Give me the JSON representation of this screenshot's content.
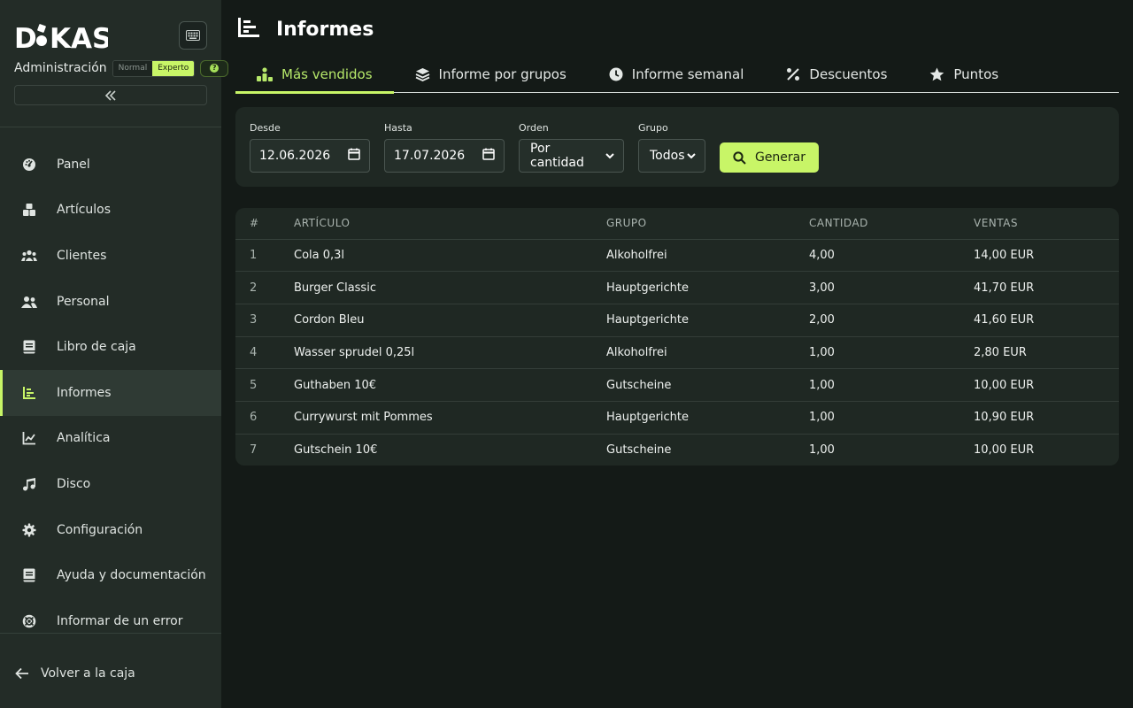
{
  "brand": {
    "logo_text": "DIKAS"
  },
  "sidebar": {
    "admin_label": "Administración",
    "mode_options": [
      "Normal",
      "Experto"
    ],
    "active_mode": "Experto",
    "help_badge": "?",
    "items": [
      {
        "label": "Panel",
        "icon": "dashboard-icon"
      },
      {
        "label": "Artículos",
        "icon": "boxes-icon"
      },
      {
        "label": "Clientes",
        "icon": "users-icon"
      },
      {
        "label": "Personal",
        "icon": "user-group-icon"
      },
      {
        "label": "Libro de caja",
        "icon": "book-icon"
      },
      {
        "label": "Informes",
        "icon": "report-icon",
        "active": true
      },
      {
        "label": "Analítica",
        "icon": "line-chart-icon"
      },
      {
        "label": "Disco",
        "icon": "music-icon"
      },
      {
        "label": "Configuración",
        "icon": "gear-icon"
      },
      {
        "label": "Ayuda y documentación",
        "icon": "help-book-icon"
      },
      {
        "label": "Informar de un error",
        "icon": "lifebuoy-icon"
      }
    ],
    "back_label": "Volver a la caja"
  },
  "header": {
    "title": "Informes"
  },
  "tabs": [
    {
      "label": "Más vendidos",
      "icon": "bestseller-icon",
      "active": true
    },
    {
      "label": "Informe por grupos",
      "icon": "layers-icon"
    },
    {
      "label": "Informe semanal",
      "icon": "clock-icon"
    },
    {
      "label": "Descuentos",
      "icon": "percent-icon"
    },
    {
      "label": "Puntos",
      "icon": "star-icon"
    }
  ],
  "filters": {
    "from_label": "Desde",
    "from_value": "12.06.2026",
    "to_label": "Hasta",
    "to_value": "17.07.2026",
    "order_label": "Orden",
    "order_value": "Por cantidad",
    "group_label": "Grupo",
    "group_value": "Todos",
    "generate_label": "Generar"
  },
  "table": {
    "columns": [
      "#",
      "ARTÍCULO",
      "GRUPO",
      "CANTIDAD",
      "VENTAS"
    ],
    "rows": [
      [
        "1",
        "Cola 0,3l",
        "Alkoholfrei",
        "4,00",
        "14,00 EUR"
      ],
      [
        "2",
        "Burger Classic",
        "Hauptgerichte",
        "3,00",
        "41,70 EUR"
      ],
      [
        "3",
        "Cordon Bleu",
        "Hauptgerichte",
        "2,00",
        "41,60 EUR"
      ],
      [
        "4",
        "Wasser sprudel 0,25l",
        "Alkoholfrei",
        "1,00",
        "2,80 EUR"
      ],
      [
        "5",
        "Guthaben 10€",
        "Gutscheine",
        "1,00",
        "10,00 EUR"
      ],
      [
        "6",
        "Currywurst mit Pommes",
        "Hauptgerichte",
        "1,00",
        "10,90 EUR"
      ],
      [
        "7",
        "Gutschein 10€",
        "Gutscheine",
        "1,00",
        "10,00 EUR"
      ]
    ]
  },
  "colors": {
    "accent": "#c8f567",
    "sidebar_bg": "#232c27",
    "page_bg": "#141a17",
    "card_bg": "#1f2823"
  }
}
